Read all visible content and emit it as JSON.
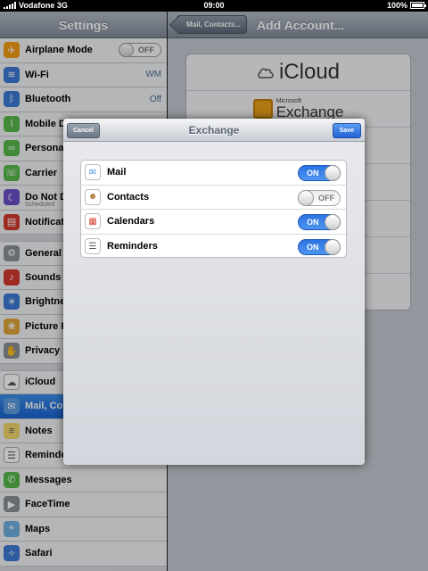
{
  "status_bar": {
    "carrier": "Vodafone 3G",
    "time": "09:00",
    "battery": "100%",
    "battery_level": 1.0,
    "signal_bars": 5
  },
  "master": {
    "title": "Settings",
    "items": [
      {
        "label": "Airplane Mode",
        "icon": "airplane-icon",
        "color": "#f39c12",
        "toggle": "OFF",
        "group_start": false
      },
      {
        "label": "Wi-Fi",
        "icon": "wifi-icon",
        "color": "#3d79d6",
        "value": "WM",
        "group_start": false
      },
      {
        "label": "Bluetooth",
        "icon": "bluetooth-icon",
        "color": "#3d79d6",
        "value": "Off",
        "group_start": false
      },
      {
        "label": "Mobile D",
        "icon": "antenna-icon",
        "color": "#57b94a",
        "group_start": false
      },
      {
        "label": "Persona",
        "icon": "link-icon",
        "color": "#57b94a",
        "group_start": false
      },
      {
        "label": "Carrier",
        "icon": "phone-icon",
        "color": "#57b94a",
        "group_start": false
      },
      {
        "label": "Do Not D",
        "icon": "moon-icon",
        "color": "#6a4fc9",
        "sub": "Scheduled",
        "group_start": false
      },
      {
        "label": "Notificat",
        "icon": "notifications-icon",
        "color": "#d33a2c",
        "group_start": false
      },
      {
        "label": "General",
        "icon": "gear-icon",
        "color": "#8b8f96",
        "group_start": true
      },
      {
        "label": "Sounds",
        "icon": "speaker-icon",
        "color": "#d33a2c",
        "group_start": false
      },
      {
        "label": "Brightne",
        "icon": "brightness-icon",
        "color": "#3d79d6",
        "group_start": false
      },
      {
        "label": "Picture F",
        "icon": "flower-icon",
        "color": "#e0a63a",
        "group_start": false
      },
      {
        "label": "Privacy",
        "icon": "hand-icon",
        "color": "#8b8f96",
        "group_start": false
      },
      {
        "label": "iCloud",
        "icon": "cloud-icon",
        "color": "#ffffff",
        "group_start": true
      },
      {
        "label": "Mail, Co",
        "icon": "envelope-icon",
        "color": "#5b9be0",
        "group_start": false,
        "selected": true
      },
      {
        "label": "Notes",
        "icon": "notepad-icon",
        "color": "#f2d86c",
        "group_start": false
      },
      {
        "label": "Reminde",
        "icon": "list-icon",
        "color": "#ffffff",
        "group_start": false
      },
      {
        "label": "Messages",
        "icon": "speech-bubble-icon",
        "color": "#57b94a",
        "group_start": false
      },
      {
        "label": "FaceTime",
        "icon": "camera-icon",
        "color": "#8b8f96",
        "group_start": false
      },
      {
        "label": "Maps",
        "icon": "map-icon",
        "color": "#6fb0e0",
        "group_start": false
      },
      {
        "label": "Safari",
        "icon": "compass-icon",
        "color": "#3d79d6",
        "group_start": false
      }
    ]
  },
  "detail": {
    "back_label": "Mail, Contacts...",
    "title": "Add Account...",
    "accounts": {
      "icloud": "iCloud",
      "exchange_small": "Microsoft",
      "exchange_big": "Exchange"
    }
  },
  "sheet": {
    "title": "Exchange",
    "cancel_label": "Cancel",
    "save_label": "Save",
    "services": [
      {
        "label": "Mail",
        "state": "ON",
        "on": true,
        "icon": "mail-icon",
        "color": "#4a90e2"
      },
      {
        "label": "Contacts",
        "state": "OFF",
        "on": false,
        "icon": "contacts-icon",
        "color": "#b07a3c"
      },
      {
        "label": "Calendars",
        "state": "ON",
        "on": true,
        "icon": "calendar-icon",
        "color": "#d8493b"
      },
      {
        "label": "Reminders",
        "state": "ON",
        "on": true,
        "icon": "reminders-icon",
        "color": "#555555"
      }
    ]
  }
}
